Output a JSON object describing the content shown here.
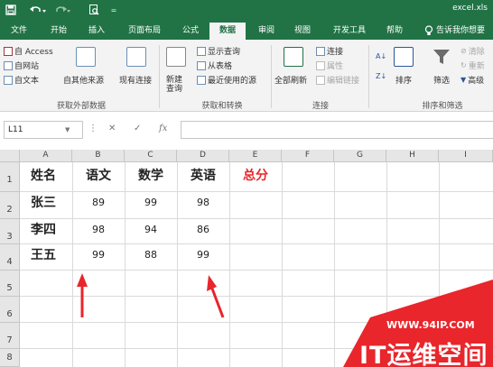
{
  "titlebar": {
    "save_icon": "save-icon",
    "undo_icon": "undo-icon",
    "redo_icon": "redo-icon",
    "preview_icon": "print-preview-icon",
    "customize_icon": "customize-qat-icon",
    "filename": "excel.xls"
  },
  "tabs": [
    "文件",
    "开始",
    "插入",
    "页面布局",
    "公式",
    "数据",
    "审阅",
    "视图",
    "开发工具",
    "帮助"
  ],
  "active_tab": "数据",
  "tell_me": "告诉我你想要",
  "ribbon": {
    "get_external": {
      "access": "自 Access",
      "web": "自网站",
      "text": "自文本",
      "other_sources": "自其他来源",
      "existing": "现有连接",
      "group": "获取外部数据"
    },
    "get_transform": {
      "new_query": "新建\n查询",
      "show_queries": "显示查询",
      "from_table": "从表格",
      "recent_sources": "最近使用的源",
      "group": "获取和转换"
    },
    "connections": {
      "refresh_all": "全部刷新",
      "connections": "连接",
      "properties": "属性",
      "edit_links": "编辑链接",
      "group": "连接"
    },
    "sort_filter": {
      "sort": "排序",
      "filter": "筛选",
      "clear": "清除",
      "reapply": "重新",
      "advanced": "高级",
      "group": "排序和筛选"
    }
  },
  "formula_bar": {
    "name_box": "L11",
    "formula": ""
  },
  "columns": [
    "A",
    "B",
    "C",
    "D",
    "E",
    "F",
    "G",
    "H",
    "I"
  ],
  "rows": [
    "1",
    "2",
    "3",
    "4",
    "5",
    "6",
    "7",
    "8"
  ],
  "cells": {
    "header": [
      "姓名",
      "语文",
      "数学",
      "英语",
      "总分"
    ],
    "data": [
      [
        "张三",
        "89",
        "99",
        "98"
      ],
      [
        "李四",
        "98",
        "94",
        "86"
      ],
      [
        "王五",
        "99",
        "88",
        "99"
      ]
    ]
  },
  "colors": {
    "excel_green": "#217346",
    "total_header": "#e8262c",
    "arrow": "#e8262c",
    "watermark": "#e8262c"
  },
  "watermark": {
    "url": "WWW.94IP.COM",
    "brand": "IT运维空间"
  }
}
